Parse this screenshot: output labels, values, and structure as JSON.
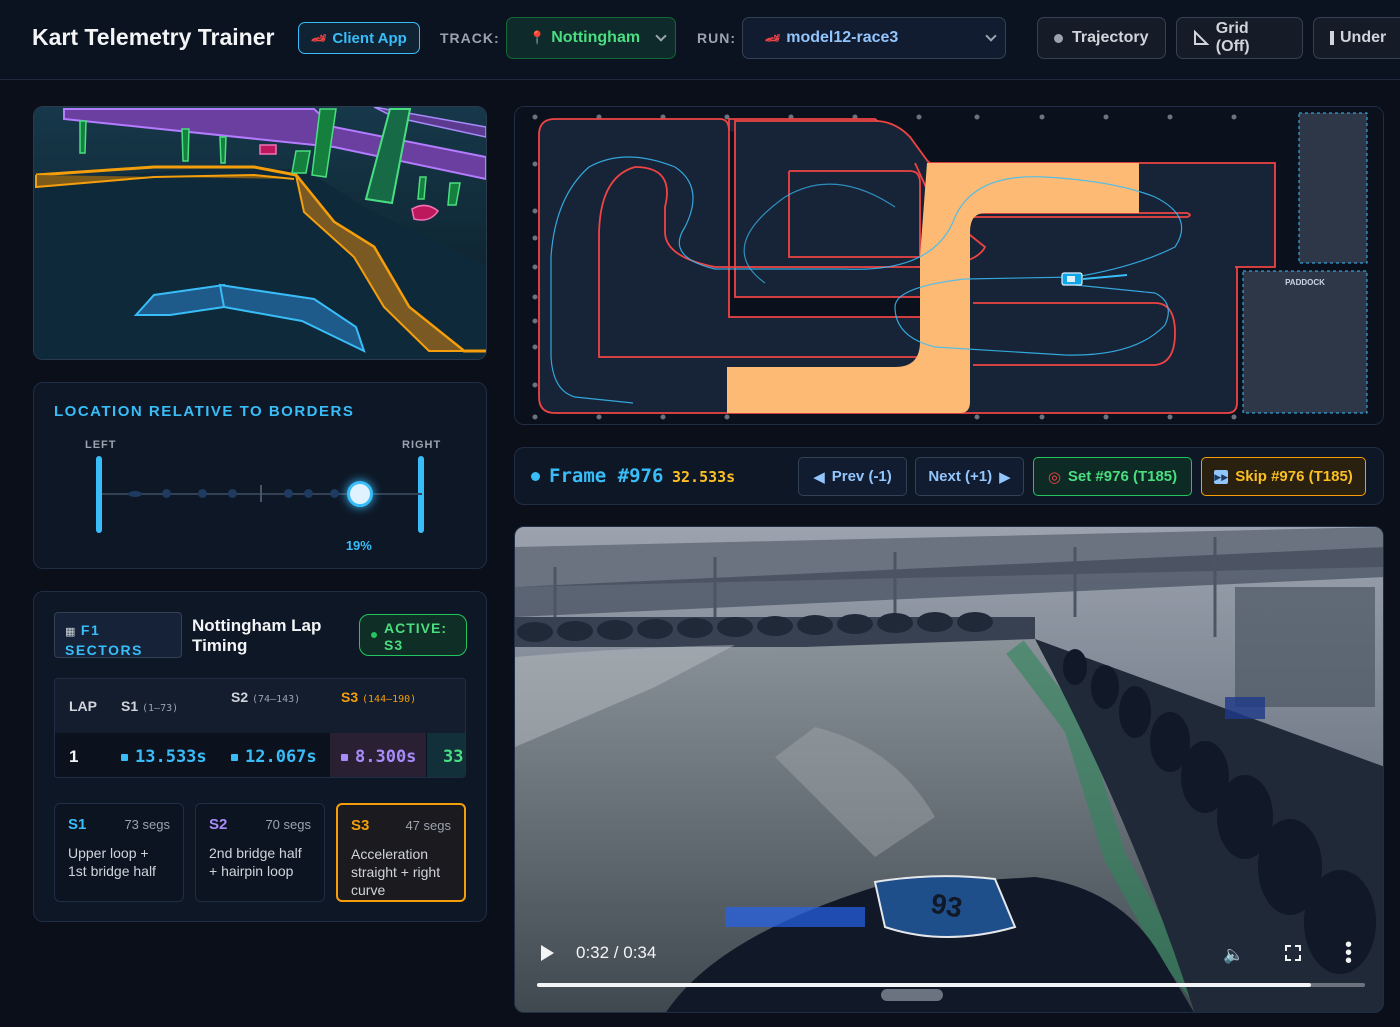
{
  "header": {
    "title": "Kart Telemetry Trainer",
    "client_app": "Client App",
    "track_label": "TRACK:",
    "track_value": "Nottingham",
    "run_label": "RUN:",
    "run_value": "model12-race3",
    "trajectory": "Trajectory",
    "grid": "Grid (Off)",
    "under": "Under"
  },
  "location": {
    "title": "LOCATION RELATIVE TO BORDERS",
    "left": "LEFT",
    "right": "RIGHT",
    "percent_label": "19%",
    "position_fraction": 0.81
  },
  "sectors": {
    "badge_line1": "F1",
    "badge_line2": "SECTORS",
    "title": "Nottingham Lap Timing",
    "active_line1": "ACTIVE:",
    "active_line2": "S3",
    "table": {
      "headers": {
        "lap": "LAP",
        "s1": "S1",
        "s1_range": "(1–73)",
        "s2": "S2",
        "s2_range": "(74–143)",
        "s3": "S3",
        "s3_range": "(144–190)"
      },
      "row": {
        "lap": "1",
        "s1": "13.533s",
        "s2": "12.067s",
        "s3": "8.300s",
        "total": "33"
      }
    },
    "cards": [
      {
        "name": "S1",
        "segs": "73 segs",
        "desc": "Upper loop + 1st bridge half",
        "color": "#38bdf8"
      },
      {
        "name": "S2",
        "segs": "70 segs",
        "desc": "2nd bridge half + hairpin loop",
        "color": "#a78bfa"
      },
      {
        "name": "S3",
        "segs": "47 segs",
        "desc": "Acceleration straight + right curve",
        "color": "#f59e0b"
      }
    ]
  },
  "map": {
    "paddock": "PADDOCK"
  },
  "frame": {
    "label": "Frame #976",
    "time": "32.533s",
    "prev": "Prev (-1)",
    "next": "Next (+1)",
    "set": "Set #976 (T185)",
    "skip": "Skip #976 (T185)"
  },
  "video": {
    "time": "0:32 / 0:34",
    "kart_number": "93",
    "progress_fraction": 0.935
  },
  "colors": {
    "accent": "#38bdf8",
    "green": "#4ade80",
    "amber": "#f59e0b",
    "purple": "#a78bfa",
    "track_border": "#ef4444",
    "bridge": "#fdba74"
  }
}
